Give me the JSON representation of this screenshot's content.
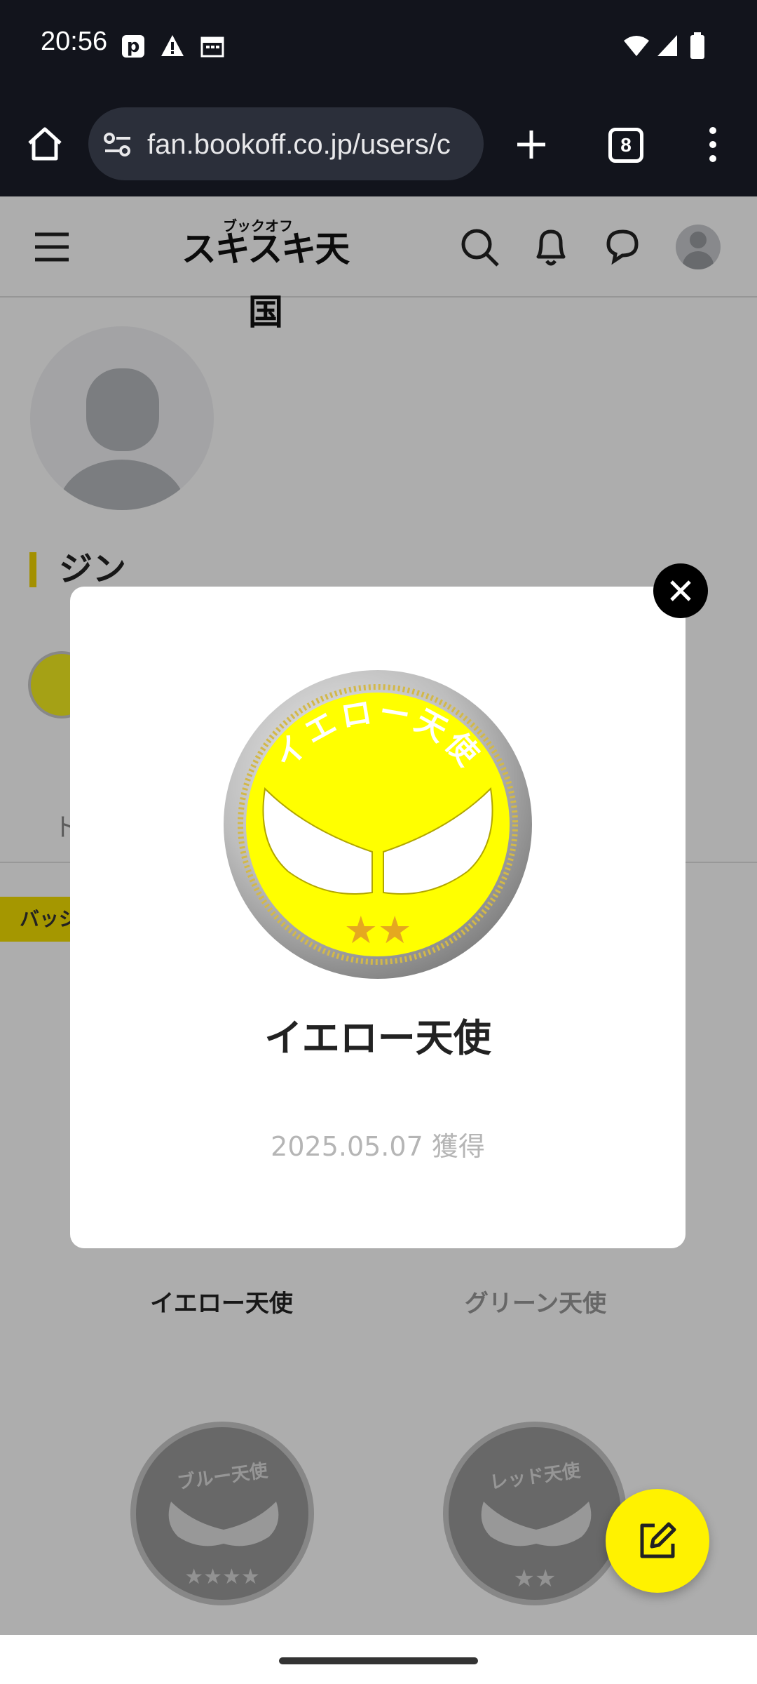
{
  "status_bar": {
    "time": "20:56",
    "icons": [
      "p-icon",
      "warning-icon",
      "calendar-icon",
      "wifi-icon",
      "signal-icon",
      "battery-icon"
    ]
  },
  "browser": {
    "url": "fan.bookoff.co.jp/users/c",
    "tab_count": "8",
    "icons": [
      "home-icon",
      "site-info-icon",
      "plus-icon",
      "tabs-icon",
      "more-icon"
    ]
  },
  "site_header": {
    "logo_ruby": "ブックオフ",
    "logo_text": "スキスキ天国",
    "icons": [
      "menu-icon",
      "search-icon",
      "bell-icon",
      "chat-icon",
      "account-icon"
    ]
  },
  "profile": {
    "name": "ジン",
    "tab_hint": "ト",
    "badge_chip": "バッジ"
  },
  "badge_grid": {
    "items": [
      {
        "label": "イエロー天使"
      },
      {
        "label": "グリーン天使"
      },
      {
        "label": "ブルー天使",
        "medal_text": "ブルー天使"
      },
      {
        "label": "レッド天使",
        "medal_text": "レッド天使"
      }
    ]
  },
  "modal": {
    "medal_text": "イエロー天使",
    "title": "イエロー天使",
    "date": "2025.05.07 獲得",
    "accent_color": "#ffff00"
  },
  "colors": {
    "brand_yellow": "#fff200",
    "chrome_bg": "#12141c"
  }
}
